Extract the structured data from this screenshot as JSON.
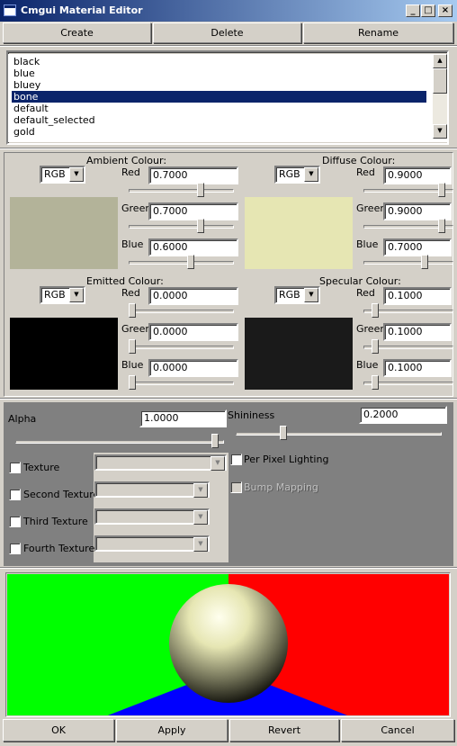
{
  "window": {
    "title": "Cmgui Material Editor",
    "minimize": "_",
    "maximize": "□",
    "close": "×"
  },
  "toolbar": {
    "create": "Create",
    "delete": "Delete",
    "rename": "Rename"
  },
  "materials": {
    "items": [
      "black",
      "blue",
      "bluey",
      "bone",
      "default",
      "default_selected",
      "gold"
    ],
    "selected": "bone"
  },
  "colours": {
    "ambient": {
      "title": "Ambient Colour:",
      "mode": "RGB",
      "swatch": "#b3b399",
      "red_label": "Red",
      "green_label": "Green",
      "blue_label": "Blue",
      "red": "0.7000",
      "green": "0.7000",
      "blue": "0.6000",
      "red_level": 0.7,
      "green_level": 0.7,
      "blue_level": 0.6
    },
    "diffuse": {
      "title": "Diffuse Colour:",
      "mode": "RGB",
      "swatch": "#e6e6b3",
      "red_label": "Red",
      "green_label": "Green",
      "blue_label": "Blue",
      "red": "0.9000",
      "green": "0.9000",
      "blue": "0.7000",
      "red_level": 0.9,
      "green_level": 0.9,
      "blue_level": 0.7
    },
    "emitted": {
      "title": "Emitted Colour:",
      "mode": "RGB",
      "swatch": "#000000",
      "red_label": "Red",
      "green_label": "Green",
      "blue_label": "Blue",
      "red": "0.0000",
      "green": "0.0000",
      "blue": "0.0000",
      "red_level": 0.0,
      "green_level": 0.0,
      "blue_level": 0.0
    },
    "specular": {
      "title": "Specular Colour:",
      "mode": "RGB",
      "swatch": "#1a1a1a",
      "red_label": "Red",
      "green_label": "Green",
      "blue_label": "Blue",
      "red": "0.1000",
      "green": "0.1000",
      "blue": "0.1000",
      "red_level": 0.1,
      "green_level": 0.1,
      "blue_level": 0.1
    }
  },
  "alpha": {
    "label": "Alpha",
    "value": "1.0000",
    "level": 1.0
  },
  "shininess": {
    "label": "Shininess",
    "value": "0.2000",
    "level": 0.2
  },
  "textures": {
    "texture": "Texture",
    "second": "Second Texture",
    "third": "Third Texture",
    "fourth": "Fourth Texture"
  },
  "options": {
    "per_pixel": "Per Pixel Lighting",
    "bump": "Bump Mapping"
  },
  "preview": {
    "bg_left": "#00ff00",
    "bg_right": "#ff0000",
    "bg_bottom": "#0000ff"
  },
  "footer": {
    "ok": "OK",
    "apply": "Apply",
    "revert": "Revert",
    "cancel": "Cancel"
  }
}
